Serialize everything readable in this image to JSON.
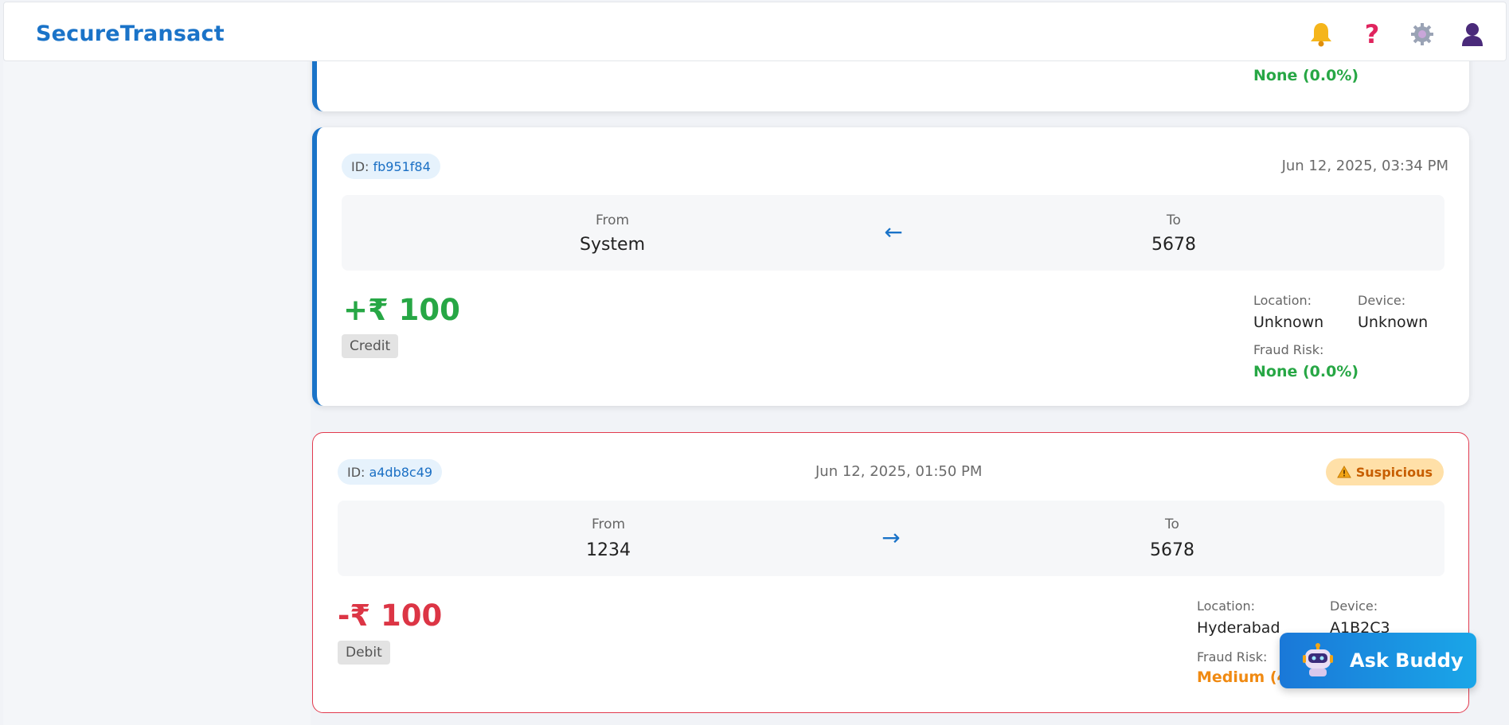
{
  "header": {
    "logo": "SecureTransact",
    "icons": [
      "bell-icon",
      "help-icon",
      "settings-icon",
      "user-icon"
    ]
  },
  "cards": [
    {
      "fraud_risk_value": "None (0.0%)"
    },
    {
      "id_label": "ID:",
      "id": "fb951f84",
      "date": "Jun 12, 2025, 03:34 PM",
      "from_label": "From",
      "from": "System",
      "to_label": "To",
      "to": "5678",
      "arrow": "←",
      "amount": "+₹ 100",
      "type": "Credit",
      "location_label": "Location:",
      "location": "Unknown",
      "device_label": "Device:",
      "device": "Unknown",
      "fraud_label": "Fraud Risk:",
      "fraud_risk_value": "None (0.0%)"
    },
    {
      "id_label": "ID:",
      "id": "a4db8c49",
      "date": "Jun 12, 2025, 01:50 PM",
      "badge": "Suspicious",
      "badge_icon": "warning-icon",
      "from_label": "From",
      "from": "1234",
      "to_label": "To",
      "to": "5678",
      "arrow": "→",
      "amount": "-₹ 100",
      "type": "Debit",
      "location_label": "Location:",
      "location": "Hyderabad",
      "device_label": "Device:",
      "device": "A1B2C3",
      "fraud_label": "Fraud Risk:",
      "fraud_risk_value": "Medium (46"
    }
  ],
  "ask_buddy": {
    "label": "Ask Buddy",
    "icon": "robot-icon"
  },
  "colors": {
    "brand": "#1a73c8",
    "credit": "#27a745",
    "debit": "#dc3545",
    "medium_risk": "#f08a12",
    "suspicious_bg": "#ffe0a8"
  }
}
